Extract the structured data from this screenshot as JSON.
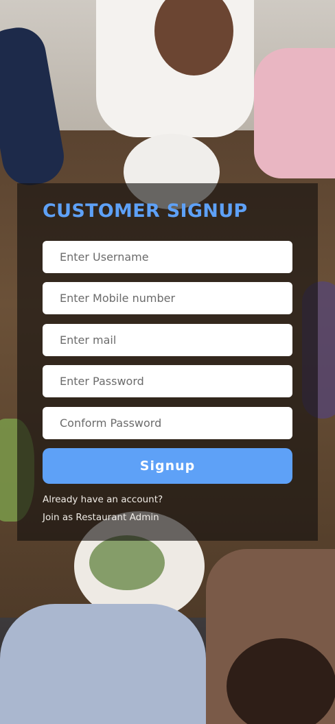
{
  "form": {
    "title": "CUSTOMER SIGNUP",
    "username_placeholder": "Enter Username",
    "mobile_placeholder": "Enter Mobile number",
    "mail_placeholder": "Enter mail",
    "password_placeholder": "Enter Password",
    "confirm_password_placeholder": "Conform Password",
    "signup_label": "Signup",
    "login_link": "Already have an account?",
    "admin_link": "Join as Restaurant Admin"
  },
  "colors": {
    "accent": "#5ea1f7",
    "field_background": "#ffffff",
    "card_overlay": "#141010"
  }
}
